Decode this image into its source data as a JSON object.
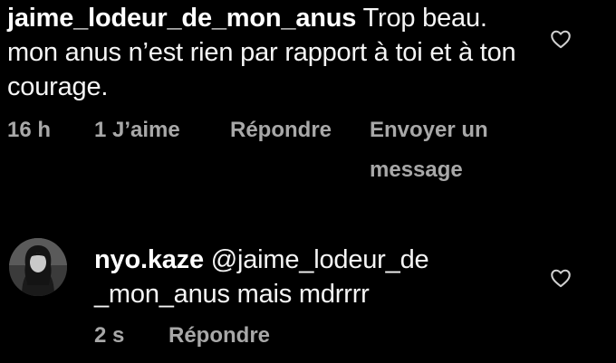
{
  "comments": [
    {
      "username": "jaime_lodeur_de_mon_anus",
      "text": " Trop beau. mon anus n’est rien par rapport à toi et à ton courage.",
      "time": "16 h",
      "likes": "1 J’aime",
      "reply": "Répondre",
      "send_message": "Envoyer un message",
      "like_icon": "heart-outline-icon"
    },
    {
      "username": "nyo.kaze",
      "text": " @jaime_lodeur_de _mon_anus mais mdrrrr",
      "time": "2 s",
      "reply": "Répondre",
      "like_icon": "heart-outline-icon",
      "avatar": "profile-avatar"
    }
  ],
  "colors": {
    "background": "#000000",
    "primary_text": "#f5f5f5",
    "secondary_text": "#a8a8a8"
  }
}
